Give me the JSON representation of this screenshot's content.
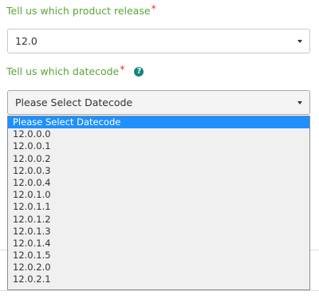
{
  "release_field": {
    "label": "Tell us which product release",
    "required_mark": "*",
    "selected_value": "12.0"
  },
  "datecode_field": {
    "label": "Tell us which datecode",
    "required_mark": "*",
    "help_icon": "help-icon",
    "selected_value": "Please Select Datecode",
    "options": [
      "Please Select Datecode",
      "12.0.0.0",
      "12.0.0.1",
      "12.0.0.2",
      "12.0.0.3",
      "12.0.0.4",
      "12.0.1.0",
      "12.0.1.1",
      "12.0.1.2",
      "12.0.1.3",
      "12.0.1.4",
      "12.0.1.5",
      "12.0.2.0",
      "12.0.2.1"
    ],
    "highlighted_option": "Please Select Datecode"
  },
  "colors": {
    "label_green": "#5aa53a",
    "required_red": "#e3342f",
    "help_icon_teal": "#14867f",
    "selection_blue": "#1e90ff"
  }
}
